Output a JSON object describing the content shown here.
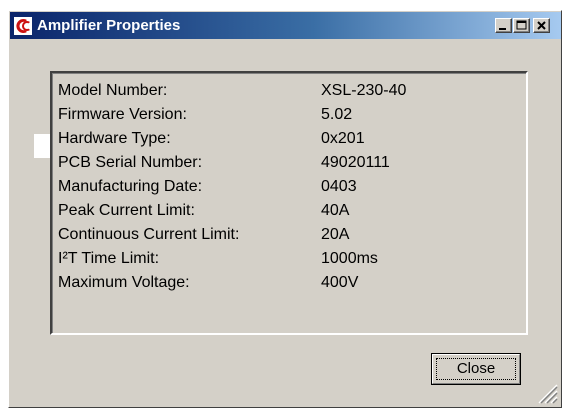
{
  "window": {
    "title": "Amplifier Properties",
    "icon": "app-logo-icon",
    "controls": [
      "minimize-icon",
      "maximize-icon",
      "close-icon"
    ]
  },
  "properties": [
    {
      "label": "Model Number:",
      "value": "XSL-230-40"
    },
    {
      "label": "Firmware Version:",
      "value": "5.02"
    },
    {
      "label": "Hardware Type:",
      "value": "0x201"
    },
    {
      "label": "PCB Serial Number:",
      "value": "49020111"
    },
    {
      "label": "Manufacturing Date:",
      "value": "0403"
    },
    {
      "label": "Peak Current Limit:",
      "value": "40A"
    },
    {
      "label": "Continuous Current Limit:",
      "value": "20A"
    },
    {
      "label": "I²T Time Limit:",
      "value": "1000ms"
    },
    {
      "label": "Maximum Voltage:",
      "value": "400V"
    }
  ],
  "buttons": {
    "close_label": "Close"
  },
  "colors": {
    "face": "#d4d0c8",
    "title_start": "#0a246a",
    "title_end": "#a6caf0",
    "logo_red": "#cc1111"
  }
}
